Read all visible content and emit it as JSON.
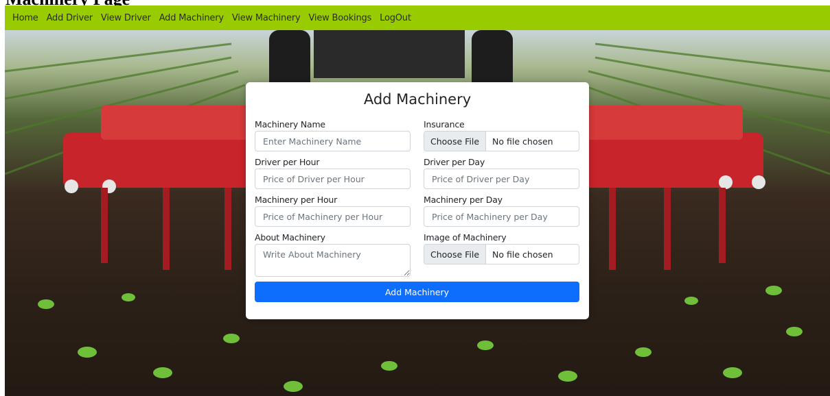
{
  "page": {
    "heading": "Machinery Page"
  },
  "nav": {
    "items": [
      {
        "label": "Home"
      },
      {
        "label": "Add Driver"
      },
      {
        "label": "View Driver"
      },
      {
        "label": "Add Machinery"
      },
      {
        "label": "View Machinery"
      },
      {
        "label": "View Bookings"
      },
      {
        "label": "LogOut"
      }
    ]
  },
  "form": {
    "title": "Add Machinery",
    "machinery_name": {
      "label": "Machinery Name",
      "placeholder": "Enter Machinery Name",
      "value": ""
    },
    "insurance": {
      "label": "Insurance",
      "button": "Choose File",
      "status": "No file chosen"
    },
    "driver_per_hour": {
      "label": "Driver per Hour",
      "placeholder": "Price of Driver per Hour",
      "value": ""
    },
    "driver_per_day": {
      "label": "Driver per Day",
      "placeholder": "Price of Driver per Day",
      "value": ""
    },
    "machinery_per_hour": {
      "label": "Machinery per Hour",
      "placeholder": "Price of Machinery per Hour",
      "value": ""
    },
    "machinery_per_day": {
      "label": "Machinery per Day",
      "placeholder": "Price of Machinery per Day",
      "value": ""
    },
    "about": {
      "label": "About Machinery",
      "placeholder": "Write About Machinery",
      "value": ""
    },
    "image": {
      "label": "Image of Machinery",
      "button": "Choose File",
      "status": "No file chosen"
    },
    "submit_label": "Add Machinery"
  },
  "colors": {
    "navbar": "#99cc00",
    "primary_button": "#0d6efd"
  }
}
